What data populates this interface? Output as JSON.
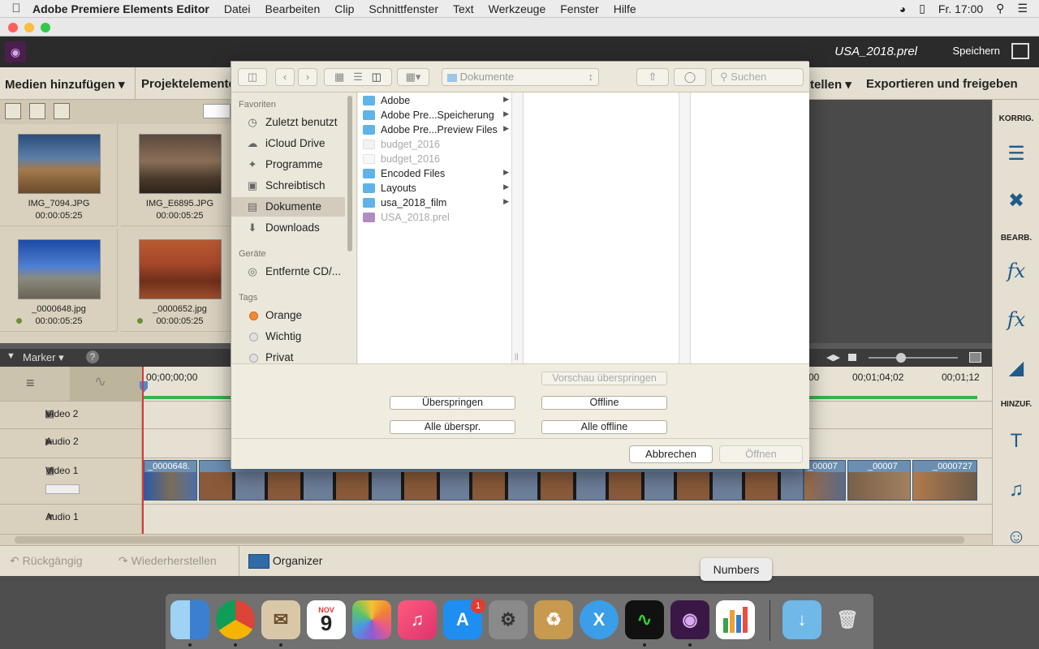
{
  "menubar": {
    "app_name": "Adobe Premiere Elements Editor",
    "items": [
      "Datei",
      "Bearbeiten",
      "Clip",
      "Schnittfenster",
      "Text",
      "Werkzeuge",
      "Fenster",
      "Hilfe"
    ],
    "clock": "Fr. 17:00"
  },
  "app": {
    "project_name": "USA_2018.prel",
    "save_label": "Speichern"
  },
  "toolbar": {
    "add_media": "Medien hinzufügen",
    "project_elements": "Projektelemente",
    "tools_partial": "tellen",
    "export": "Exportieren und freigeben"
  },
  "media": {
    "tiles": [
      {
        "name": "IMG_7094.JPG",
        "time": "00:00:05:25"
      },
      {
        "name": "IMG_E6895.JPG",
        "time": "00:00:05:25"
      },
      {
        "name": "_0000648.jpg",
        "time": "00:00:05:25"
      },
      {
        "name": "_0000652.jpg",
        "time": "00:00:05:25"
      }
    ]
  },
  "sidebar": {
    "korrig": "KORRIG.",
    "bearb": "BEARB.",
    "hinzuf": "HINZUF."
  },
  "timeline": {
    "marker_label": "Marker",
    "timecodes": [
      "00;00;00;00",
      "00",
      "00;01;04;02",
      "00;01;12"
    ],
    "tracks": [
      "Video 2",
      "Audio 2",
      "Video 1",
      "Audio 1"
    ],
    "clip_labels": [
      "_0000648.",
      "_00007",
      "_00007",
      "_0000727"
    ]
  },
  "bottom": {
    "undo": "Rückgängig",
    "redo": "Wiederherstellen",
    "organizer": "Organizer"
  },
  "dock": {
    "tooltip": "Numbers",
    "calendar_month": "NOV",
    "calendar_day": "9",
    "appstore_badge": "1"
  },
  "dialog": {
    "path": "Dokumente",
    "search_placeholder": "Suchen",
    "sidebar": {
      "favorites_header": "Favoriten",
      "favorites": [
        "Zuletzt benutzt",
        "iCloud Drive",
        "Programme",
        "Schreibtisch",
        "Dokumente",
        "Downloads"
      ],
      "devices_header": "Geräte",
      "devices": [
        "Entfernte CD/..."
      ],
      "tags_header": "Tags",
      "tags": [
        {
          "name": "Orange",
          "color": "#f0883a"
        },
        {
          "name": "Wichtig",
          "color": "#e0e0e0"
        },
        {
          "name": "Privat",
          "color": "#e0e0e0"
        }
      ]
    },
    "files": [
      {
        "name": "Adobe",
        "type": "folder",
        "arrow": true,
        "dim": false
      },
      {
        "name": "Adobe Pre...Speicherung",
        "type": "folder",
        "arrow": true,
        "dim": false
      },
      {
        "name": "Adobe Pre...Preview Files",
        "type": "folder",
        "arrow": true,
        "dim": false
      },
      {
        "name": "budget_2016",
        "type": "file",
        "arrow": false,
        "dim": true
      },
      {
        "name": "budget_2016",
        "type": "file",
        "arrow": false,
        "dim": true
      },
      {
        "name": "Encoded Files",
        "type": "folder",
        "arrow": true,
        "dim": false
      },
      {
        "name": "Layouts",
        "type": "folder",
        "arrow": true,
        "dim": false
      },
      {
        "name": "usa_2018_film",
        "type": "folder",
        "arrow": true,
        "dim": false
      },
      {
        "name": "USA_2018.prel",
        "type": "project",
        "arrow": false,
        "dim": true
      }
    ],
    "buttons": {
      "skip_preview": "Vorschau überspringen",
      "skip": "Überspringen",
      "offline": "Offline",
      "skip_all": "Alle überspr.",
      "all_offline": "Alle offline",
      "cancel": "Abbrechen",
      "open": "Öffnen"
    }
  },
  "colors": {
    "folder": "#5fb3e6",
    "accent": "#1f5b8a",
    "playhead": "#d23b3b"
  }
}
